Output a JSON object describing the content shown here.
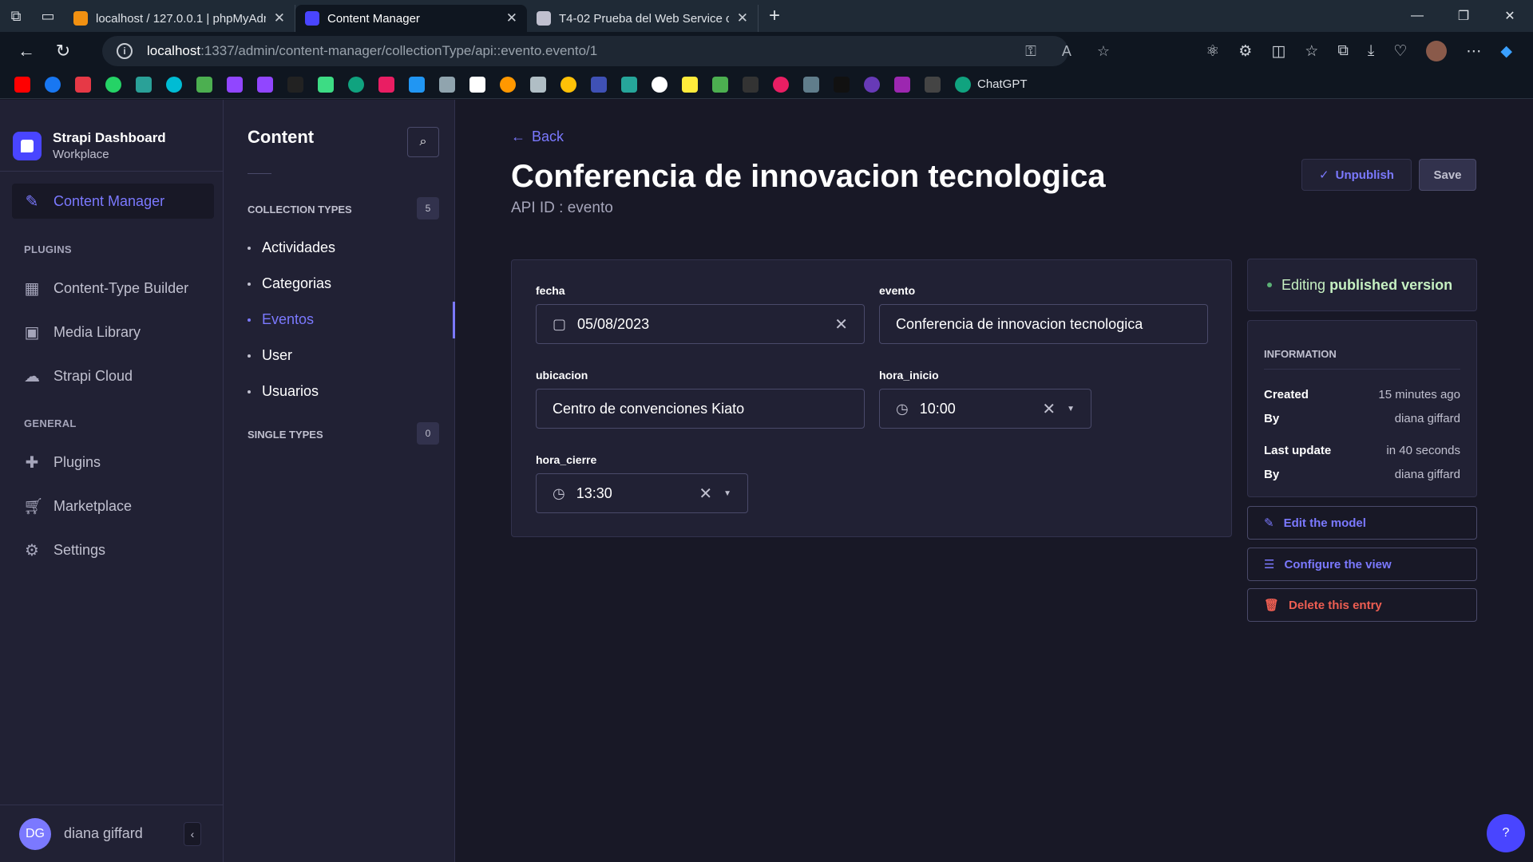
{
  "browser": {
    "tabs": [
      {
        "title": "localhost / 127.0.0.1 | phpMyAdm",
        "favicon_color": "#f29111"
      },
      {
        "title": "Content Manager",
        "favicon_color": "#4945ff"
      },
      {
        "title": "T4-02 Prueba del Web Service co",
        "favicon_color": "#c0c0cf"
      }
    ],
    "url_host": "localhost",
    "url_path": ":1337/admin/content-manager/collectionType/api::evento.evento/1",
    "bookmark_last": "ChatGPT"
  },
  "brand": {
    "name": "Strapi Dashboard",
    "subtitle": "Workplace",
    "accent": "#4945ff"
  },
  "main_nav": {
    "active": {
      "label": "Content Manager",
      "icon": "pencil-doc-icon"
    },
    "plugins_label": "PLUGINS",
    "plugins": [
      {
        "label": "Content-Type Builder",
        "icon": "layout-icon"
      },
      {
        "label": "Media Library",
        "icon": "image-icon"
      },
      {
        "label": "Strapi Cloud",
        "icon": "cloud-icon"
      }
    ],
    "general_label": "GENERAL",
    "general": [
      {
        "label": "Plugins",
        "icon": "puzzle-icon"
      },
      {
        "label": "Marketplace",
        "icon": "cart-icon"
      },
      {
        "label": "Settings",
        "icon": "gear-icon"
      }
    ],
    "user": {
      "initials": "DG",
      "name": "diana giffard"
    }
  },
  "sub_nav": {
    "title": "Content",
    "collection_label": "COLLECTION TYPES",
    "collection_count": "5",
    "collection_items": [
      "Actividades",
      "Categorias",
      "Eventos",
      "User",
      "Usuarios"
    ],
    "active_item": "Eventos",
    "single_label": "SINGLE TYPES",
    "single_count": "0"
  },
  "header": {
    "back": "Back",
    "title": "Conferencia de innovacion tecnologica",
    "api_id": "API ID : evento",
    "unpublish": "Unpublish",
    "save": "Save"
  },
  "form": {
    "fecha_label": "fecha",
    "fecha_value": "05/08/2023",
    "evento_label": "evento",
    "evento_value": "Conferencia de innovacion tecnologica",
    "ubicacion_label": "ubicacion",
    "ubicacion_value": "Centro de convenciones Kiato",
    "hora_inicio_label": "hora_inicio",
    "hora_inicio_value": "10:00",
    "hora_cierre_label": "hora_cierre",
    "hora_cierre_value": "13:30"
  },
  "status": {
    "prefix": "Editing",
    "strong": "published version"
  },
  "information": {
    "title": "INFORMATION",
    "created_label": "Created",
    "created_value": "15 minutes ago",
    "by1_label": "By",
    "by1_value": "diana giffard",
    "updated_label": "Last update",
    "updated_value": "in 40 seconds",
    "by2_label": "By",
    "by2_value": "diana giffard"
  },
  "actions": {
    "edit_model": "Edit the model",
    "configure_view": "Configure the view",
    "delete_entry": "Delete this entry"
  },
  "help": "?"
}
